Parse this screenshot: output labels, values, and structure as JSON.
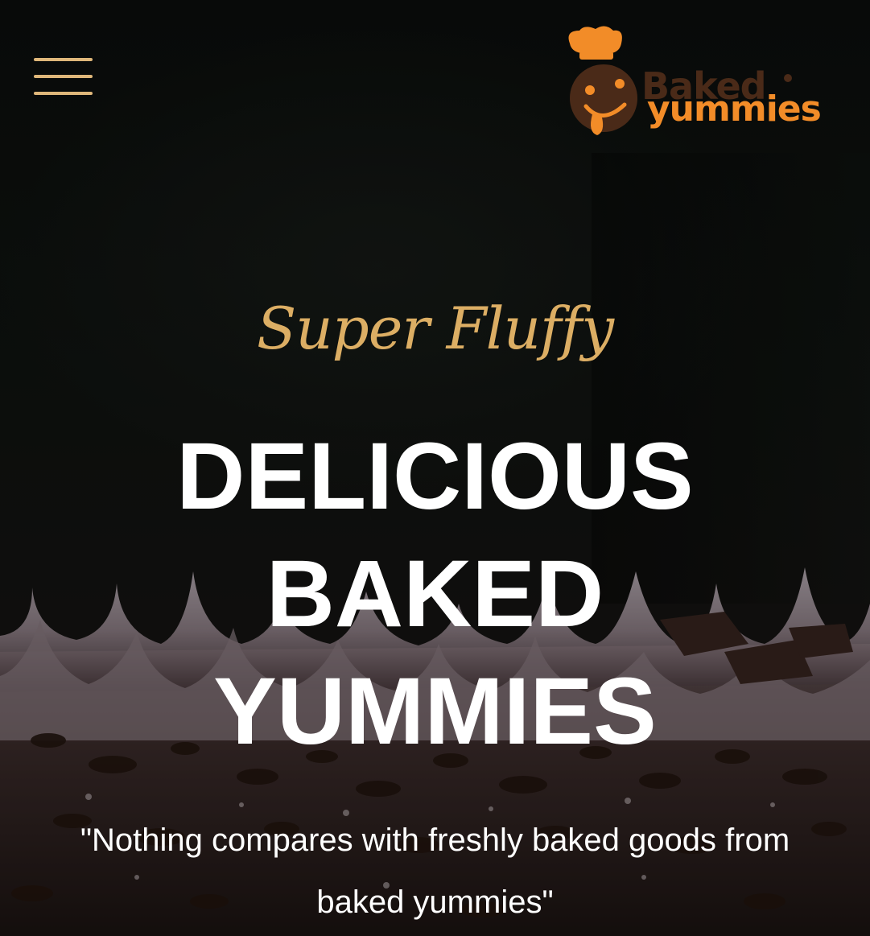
{
  "header": {
    "menu_icon": "hamburger-icon",
    "logo": {
      "word_top": "Baked",
      "word_bottom": "yummies",
      "mascot_icon": "chef-mascot-icon"
    }
  },
  "hero": {
    "tagline": "Super Fluffy",
    "headline_lines": [
      "DELICIOUS",
      "BAKED",
      "YUMMIES"
    ],
    "quote": "\"Nothing compares with freshly baked goods from baked yummies\""
  },
  "colors": {
    "accent_gold": "#dcae64",
    "menu_gold": "#dfb77a",
    "logo_brown": "#4a2a18",
    "logo_orange": "#f28c28",
    "text_white": "#ffffff",
    "background": "#0e100e"
  }
}
